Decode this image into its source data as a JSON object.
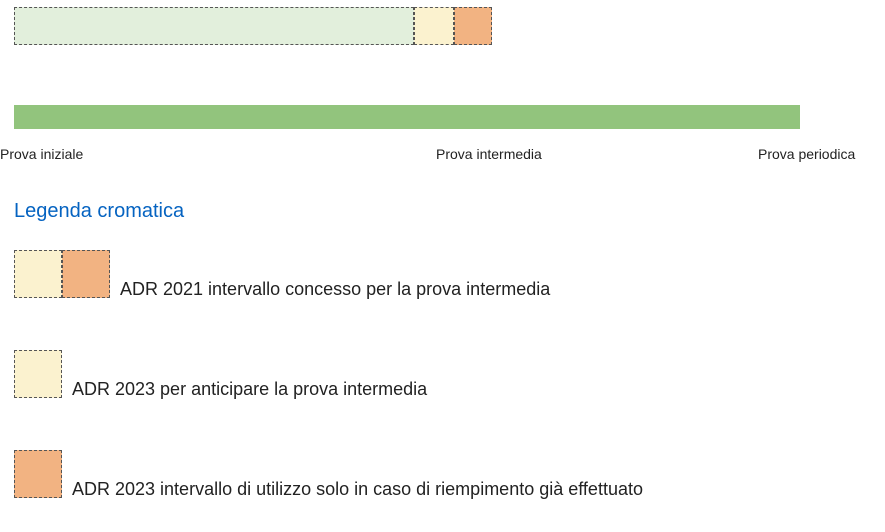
{
  "timeline": {
    "label_start": "Prova iniziale",
    "label_mid": "Prova intermedia",
    "label_end": "Prova periodica"
  },
  "legend": {
    "title": "Legenda cromatica",
    "items": [
      {
        "label": "ADR 2021 intervallo concesso per la prova intermedia"
      },
      {
        "label": "ADR 2023 per anticipare la prova intermedia"
      },
      {
        "label": "ADR 2023 intervallo di utilizzo solo in caso di riempimento già effettuato"
      }
    ]
  },
  "colors": {
    "light_green": "#e2efdc",
    "solid_green": "#92c47d",
    "cream": "#fbf2cf",
    "orange": "#f2b382",
    "link_blue": "#0563c1"
  },
  "chart_data": {
    "type": "bar",
    "description": "Timeline of test intervals",
    "top_bar_segments": [
      {
        "name": "base-period-light-green",
        "width_fraction": 0.836,
        "color": "#e2efdc"
      },
      {
        "name": "cream-interval",
        "width_fraction": 0.084,
        "color": "#fbf2cf"
      },
      {
        "name": "orange-interval",
        "width_fraction": 0.08,
        "color": "#f2b382"
      }
    ],
    "full_bar": {
      "name": "full-period-green",
      "width_fraction": 1.0,
      "color": "#92c47d"
    },
    "timeline_markers": [
      "Prova iniziale",
      "Prova intermedia",
      "Prova periodica"
    ]
  }
}
